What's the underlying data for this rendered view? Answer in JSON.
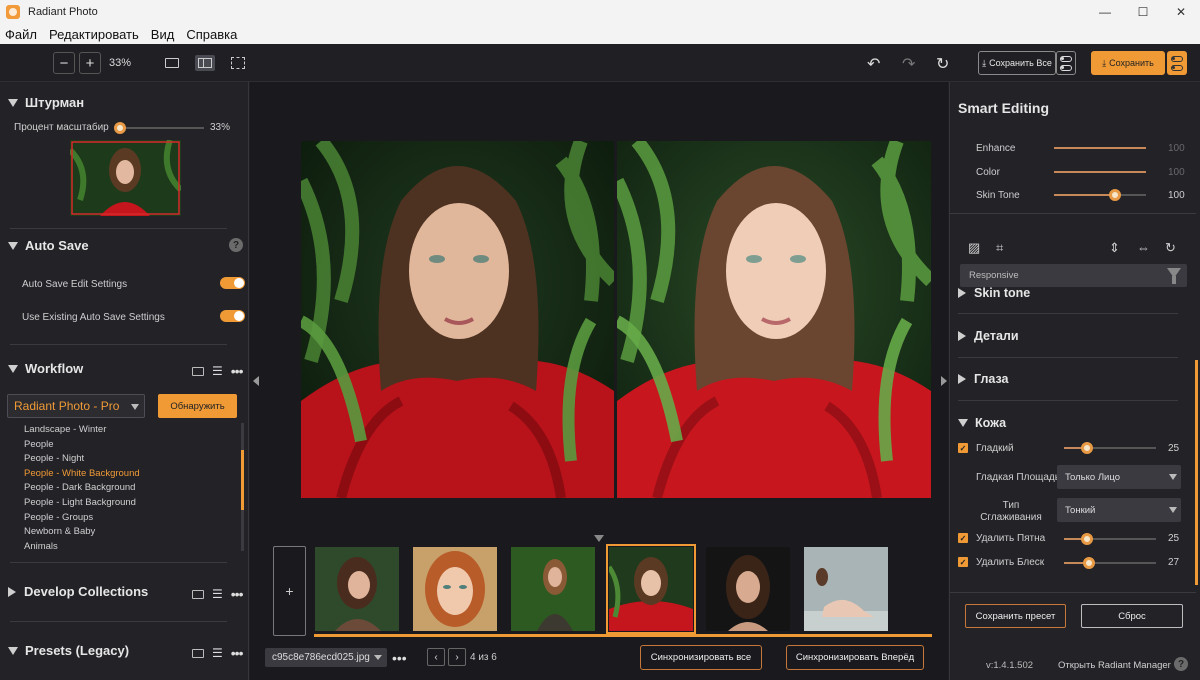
{
  "window": {
    "title": "Radiant Photo",
    "min": "—",
    "max": "☐",
    "close": "✕"
  },
  "menu": [
    "Файл",
    "Редактировать",
    "Вид",
    "Справка"
  ],
  "toolbar": {
    "zoom_out": "−",
    "zoom_in": "+",
    "zoom": "33%",
    "undo": "↶",
    "redo": "↷",
    "reset": "↻",
    "save_all": "Сохранить Все",
    "save": "Сохранить"
  },
  "left": {
    "navigator": {
      "title": "Штурман",
      "zoom_label": "Процент масштабир",
      "zoom_value": "33%",
      "zoom_level": 0.05
    },
    "autosave": {
      "title": "Auto Save",
      "help": "?",
      "items": [
        {
          "label": "Auto Save Edit Settings",
          "on": true
        },
        {
          "label": "Use Existing Auto Save Settings",
          "on": true
        }
      ]
    },
    "workflow": {
      "title": "Workflow",
      "selected": "Radiant Photo - Pro",
      "discover": "Обнаружить",
      "presets": [
        "Landscape - Winter",
        "People",
        "People - Night",
        "People - White Background",
        "People - Dark Background",
        "People - Light Background",
        "People - Groups",
        "Newborn & Baby",
        "Animals"
      ],
      "active_index": 3
    },
    "develop": {
      "title": "Develop Collections"
    },
    "presets_legacy": {
      "title": "Presets (Legacy)"
    }
  },
  "center": {
    "file_name": "c95c8e786ecd025.jpg",
    "page": "4 из 6",
    "prev": "‹",
    "next": "›",
    "add": "+",
    "sync_all": "Синхронизировать все",
    "sync_forward": "Синхронизировать Вперёд"
  },
  "right": {
    "title": "Smart Editing",
    "smart": [
      {
        "label": "Enhance",
        "value": "100",
        "level": 1.0,
        "dim": true
      },
      {
        "label": "Color",
        "value": "100",
        "level": 1.0,
        "dim": true
      },
      {
        "label": "Skin Tone",
        "value": "100",
        "level": 0.66,
        "dim": false
      }
    ],
    "filter": "Responsive",
    "sections": [
      "Skin tone",
      "Детали",
      "Глаза",
      "Кожа"
    ],
    "skin": {
      "smooth": {
        "label": "Гладкий",
        "value": "25",
        "level": 0.25
      },
      "smooth_area": {
        "label": "Гладкая Площадь",
        "value": "Только Лицо"
      },
      "smooth_type": {
        "label": "Тип Сглаживания",
        "value": "Тонкий"
      },
      "spots": {
        "label": "Удалить Пятна",
        "value": "25",
        "level": 0.25
      },
      "shine": {
        "label": "Удалить Блеск",
        "value": "27",
        "level": 0.27
      }
    },
    "save_preset": "Сохранить пресет",
    "reset": "Сброс",
    "version": "v:1.4.1.502",
    "manager": "Открыть Radiant Manager",
    "help": "?"
  },
  "colors": {
    "accent": "#f09a36",
    "panel": "#222227",
    "canvas": "#1a191e"
  }
}
